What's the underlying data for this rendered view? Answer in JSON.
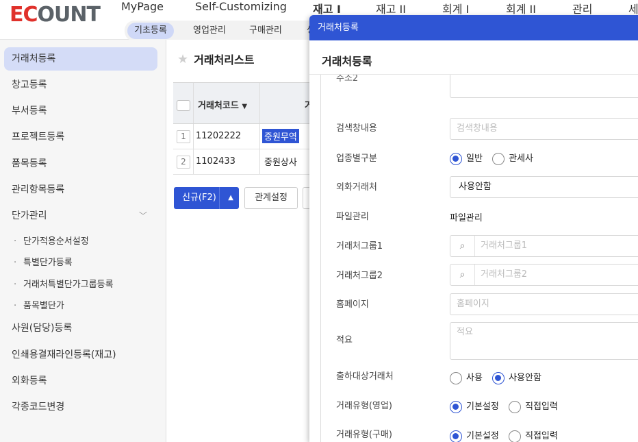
{
  "header": {
    "logo": "ECOUNT",
    "nav": [
      "MyPage",
      "Self-Customizing",
      "재고 I",
      "재고 II",
      "회계 I",
      "회계 II",
      "관리",
      "세"
    ],
    "active_nav": "재고 I",
    "subnav": [
      "기초등록",
      "영업관리",
      "구매관리",
      "생"
    ]
  },
  "sidebar": {
    "items": [
      {
        "label": "거래처등록",
        "active": true
      },
      {
        "label": "창고등록"
      },
      {
        "label": "부서등록"
      },
      {
        "label": "프로젝트등록"
      },
      {
        "label": "품목등록"
      },
      {
        "label": "관리항목등록"
      },
      {
        "label": "단가관리"
      },
      {
        "label": "사원(담당)등록"
      },
      {
        "label": "인쇄용결재라인등록(재고)"
      },
      {
        "label": "외화등록"
      },
      {
        "label": "각종코드변경"
      }
    ],
    "sub_items": [
      "단가적용순서설정",
      "특별단가등록",
      "거래처특별단가그룹등록",
      "품목별단가"
    ]
  },
  "list": {
    "title": "거래처리스트",
    "column_code": "거래처코드",
    "column_name_partial": "거",
    "rows": [
      {
        "num": "1",
        "code": "11202222",
        "name": "중원무역"
      },
      {
        "num": "2",
        "code": "1102433",
        "name": "중원상사"
      }
    ],
    "new_button": "신규(F2)",
    "relation_button": "관계설정"
  },
  "modal": {
    "bar_title": "거래처등록",
    "title": "거래처등록",
    "top_label_partial": "주소2",
    "fields": {
      "search_content": {
        "label": "검색창내용",
        "placeholder": "검색창내용"
      },
      "business_type": {
        "label": "업종별구분",
        "options": [
          "일반",
          "관세사"
        ],
        "selected": "일반"
      },
      "foreign": {
        "label": "외화거래처",
        "value": "사용안함"
      },
      "file": {
        "label": "파일관리",
        "value": "파일관리"
      },
      "group1": {
        "label": "거래처그룹1",
        "placeholder": "거래처그룹1"
      },
      "group2": {
        "label": "거래처그룹2",
        "placeholder": "거래처그룹2"
      },
      "homepage": {
        "label": "홈페이지",
        "placeholder": "홈페이지"
      },
      "memo": {
        "label": "적요",
        "placeholder": "적요"
      },
      "shipping": {
        "label": "출하대상거래처",
        "options": [
          "사용",
          "사용안함"
        ],
        "selected": "사용안함"
      },
      "trade_sales": {
        "label": "거래유형(영업)",
        "options": [
          "기본설정",
          "직접입력"
        ],
        "selected": "기본설정"
      },
      "trade_purchase": {
        "label": "거래유형(구매)",
        "options": [
          "기본설정",
          "직접입력"
        ],
        "selected": "기본설정"
      }
    }
  },
  "colors": {
    "accent": "#2f55d4",
    "logo_red": "#e0312b",
    "logo_gray": "#5b6268",
    "active_bg": "#d4dcf7"
  }
}
